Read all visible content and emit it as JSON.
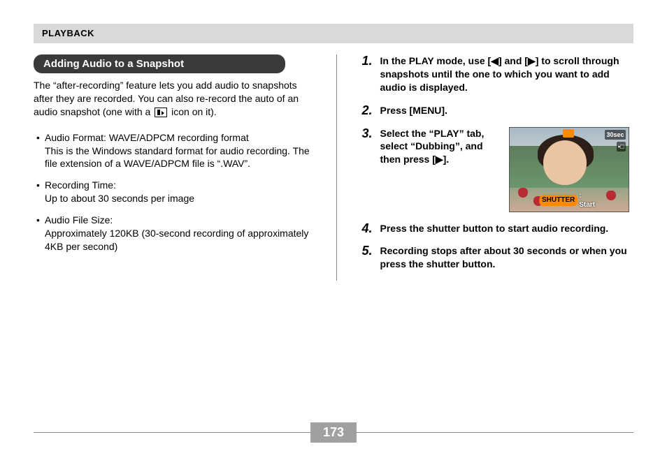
{
  "header": "PLAYBACK",
  "left": {
    "section_title": "Adding Audio to a Snapshot",
    "intro_before_icon": "The “after-recording” feature lets you add audio to snapshots after they are recorded. You can also re-record the auto of an audio snapshot (one with a ",
    "intro_after_icon": " icon on it).",
    "bullets": [
      {
        "title": "Audio Format: WAVE/ADPCM recording format",
        "detail": "This is the Windows standard format for audio recording. The file extension of a WAVE/ADPCM file is “.WAV”."
      },
      {
        "title": "Recording Time:",
        "detail": "Up to about 30 seconds per image"
      },
      {
        "title": "Audio File Size:",
        "detail": "Approximately 120KB (30-second recording of approximately 4KB per second)"
      }
    ]
  },
  "right": {
    "steps": [
      {
        "num": "1.",
        "text": "In the PLAY mode, use [◀] and [▶] to scroll through snapshots until the one to which you want to add audio is displayed."
      },
      {
        "num": "2.",
        "text": "Press [MENU]."
      },
      {
        "num": "3.",
        "text": "Select the “PLAY” tab, select “Dubbing”, and then press [▶]."
      },
      {
        "num": "4.",
        "text": "Press the shutter button to start audio recording."
      },
      {
        "num": "5.",
        "text": "Recording stops after about 30 seconds or when you press the shutter button."
      }
    ],
    "preview": {
      "timer": "30sec",
      "lock": "•□",
      "shutter": "SHUTTER",
      "start": ": Start"
    }
  },
  "page_number": "173"
}
